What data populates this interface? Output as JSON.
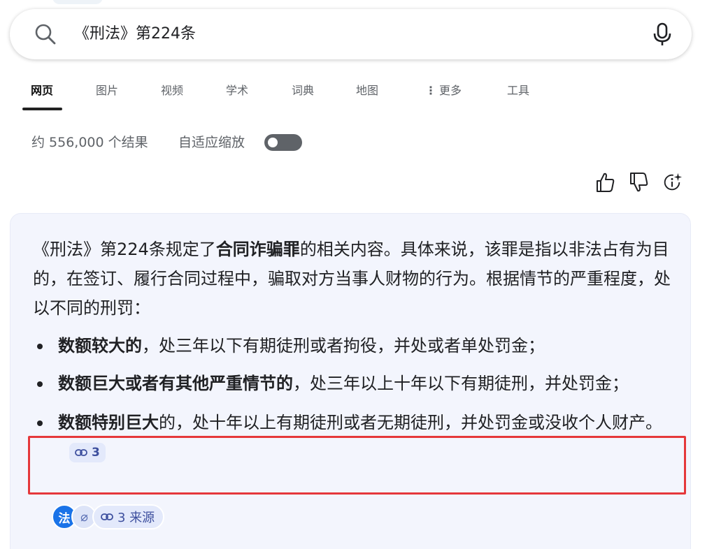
{
  "search": {
    "query": "《刑法》第224条"
  },
  "tabs": [
    {
      "label": "网页"
    },
    {
      "label": "图片"
    },
    {
      "label": "视频"
    },
    {
      "label": "学术"
    },
    {
      "label": "词典"
    },
    {
      "label": "地图"
    },
    {
      "label": "更多"
    },
    {
      "label": "工具"
    }
  ],
  "results": {
    "count_text": "约 556,000 个结果",
    "adaptive_zoom_label": "自适应缩放",
    "adaptive_zoom_on": false
  },
  "feedback_icons": [
    "thumbs-up-icon",
    "thumbs-down-icon",
    "info-sparkle-icon"
  ],
  "answer": {
    "intro_prefix": "《刑法》第224条规定了",
    "intro_bold": "合同诈骗罪",
    "intro_suffix": "的相关内容。具体来说，该罪是指以非法占有为目的，在签订、履行合同过程中，骗取对方当事人财物的行为。根据情节的严重程度，处以不同的刑罚：",
    "bullets": [
      {
        "bold": "数额较大的",
        "text": "，处三年以下有期徒刑或者拘役，并处或者单处罚金；"
      },
      {
        "bold": "数额巨大或者有其他严重情节的",
        "text": "，处三年以上十年以下有期徒刑，并处罚金；"
      },
      {
        "bold": "数额特别巨大",
        "text": "的，处十年以上有期徒刑或者无期徒刑，并处罚金或没收个人财产。",
        "citation": "3"
      }
    ],
    "sources": {
      "icon1_text": "法",
      "icon2_text": "⌀",
      "label": "3 来源"
    }
  },
  "colors": {
    "accent": "#1a73e8",
    "highlight_border": "#e5383b",
    "card_background": "#f3f5fd",
    "chip_background": "#e3e9fb"
  }
}
